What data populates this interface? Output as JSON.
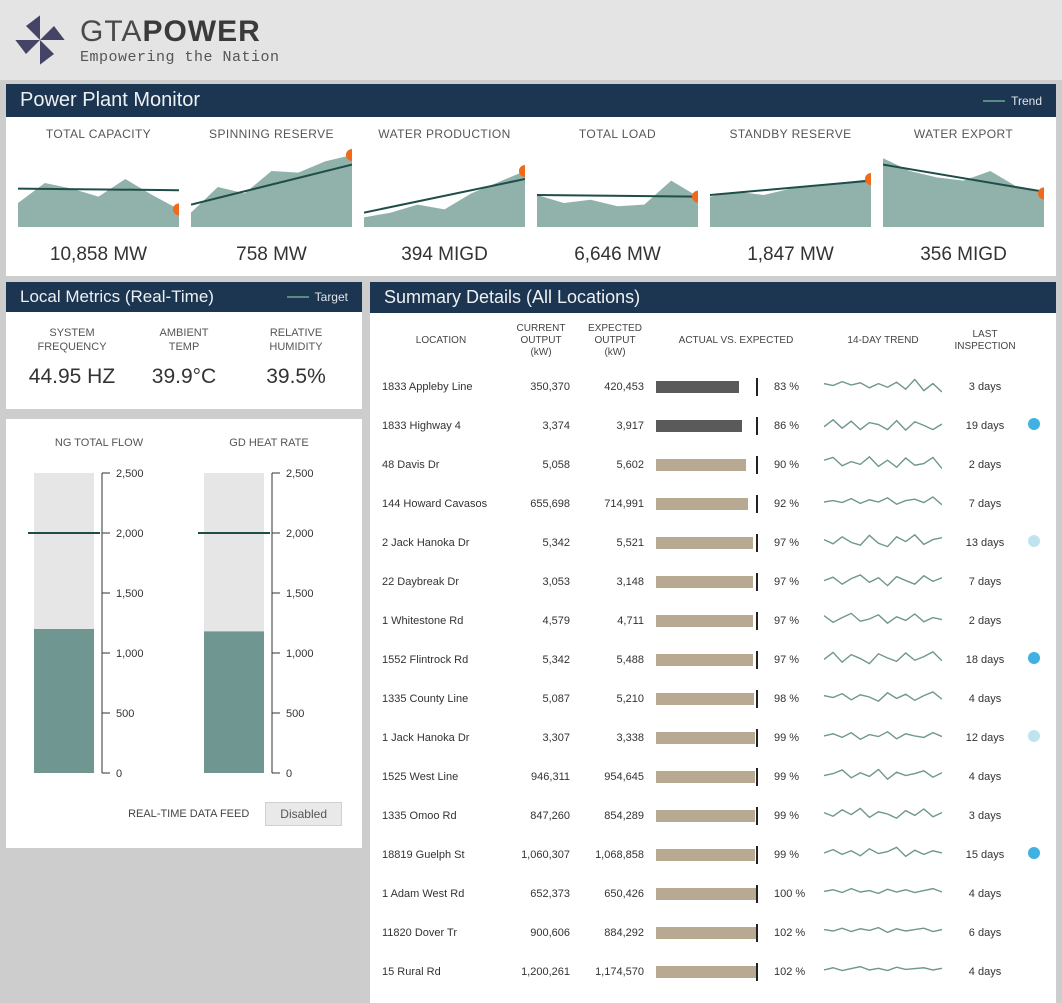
{
  "brand": {
    "name1": "GTA",
    "name2": "POWER",
    "tagline": "Empowering the Nation"
  },
  "sections": {
    "monitor": "Power Plant Monitor",
    "local": "Local Metrics (Real-Time)",
    "summary": "Summary Details (All Locations)"
  },
  "legend": {
    "trend": "Trend",
    "target": "Target"
  },
  "chart_data": {
    "sparks": [
      {
        "title": "TOTAL CAPACITY",
        "value": "10,858 MW",
        "area": [
          30,
          55,
          48,
          38,
          60,
          40,
          22
        ],
        "trend_y": [
          48,
          46
        ],
        "dot": [
          6,
          22
        ]
      },
      {
        "title": "SPINNING RESERVE",
        "value": "758 MW",
        "area": [
          18,
          50,
          42,
          70,
          68,
          82,
          90
        ],
        "trend_y": [
          28,
          78
        ],
        "dot": [
          6,
          90
        ]
      },
      {
        "title": "WATER PRODUCTION",
        "value": "394 MIGD",
        "area": [
          12,
          18,
          28,
          22,
          42,
          56,
          70
        ],
        "trend_y": [
          18,
          60
        ],
        "dot": [
          6,
          70
        ]
      },
      {
        "title": "TOTAL LOAD",
        "value": "6,646 MW",
        "area": [
          40,
          30,
          34,
          26,
          28,
          58,
          38
        ],
        "trend_y": [
          40,
          38
        ],
        "dot": [
          6,
          38
        ]
      },
      {
        "title": "STANDBY RESERVE",
        "value": "1,847 MW",
        "area": [
          38,
          44,
          40,
          48,
          52,
          56,
          60
        ],
        "trend_y": [
          40,
          58
        ],
        "dot": [
          6,
          60
        ]
      },
      {
        "title": "WATER EXPORT",
        "value": "356 MIGD",
        "area": [
          86,
          70,
          62,
          58,
          70,
          50,
          42
        ],
        "trend_y": [
          78,
          44
        ],
        "dot": [
          6,
          42
        ]
      }
    ],
    "local_bars": [
      {
        "title": "NG TOTAL FLOW",
        "max": 2500,
        "value": 1200,
        "target": 2000,
        "ticks": [
          0,
          500,
          1000,
          1500,
          2000,
          2500
        ]
      },
      {
        "title": "GD HEAT RATE",
        "max": 2500,
        "value": 1180,
        "target": 2000,
        "ticks": [
          0,
          500,
          1000,
          1500,
          2000,
          2500
        ]
      }
    ]
  },
  "metrics": [
    {
      "title1": "SYSTEM",
      "title2": "FREQUENCY",
      "value": "44.95 HZ"
    },
    {
      "title1": "AMBIENT",
      "title2": "TEMP",
      "value": "39.9°C"
    },
    {
      "title1": "RELATIVE",
      "title2": "HUMIDITY",
      "value": "39.5%"
    }
  ],
  "feed": {
    "label": "REAL-TIME DATA FEED",
    "state": "Disabled"
  },
  "summary": {
    "headers": {
      "location": "LOCATION",
      "current": "CURRENT OUTPUT (kW)",
      "expected": "EXPECTED OUTPUT (kW)",
      "actual": "ACTUAL VS. EXPECTED",
      "trend": "14-DAY TREND",
      "insp": "LAST INSPECTION"
    },
    "rows": [
      {
        "loc": "1833 Appleby Line",
        "cur": "350,370",
        "exp": "420,453",
        "pct": 83,
        "dark": true,
        "insp": "3 days",
        "dot": "",
        "trend": [
          55,
          48,
          62,
          50,
          58,
          40,
          55,
          42,
          60,
          35,
          70,
          30,
          55,
          25
        ]
      },
      {
        "loc": "1833 Highway 4",
        "cur": "3,374",
        "exp": "3,917",
        "pct": 86,
        "dark": true,
        "insp": "19 days",
        "dot": "blue",
        "trend": [
          40,
          65,
          35,
          60,
          30,
          55,
          48,
          30,
          62,
          28,
          58,
          45,
          30,
          50
        ]
      },
      {
        "loc": "48 Davis Dr",
        "cur": "5,058",
        "exp": "5,602",
        "pct": 90,
        "insp": "2 days",
        "dot": "",
        "trend": [
          60,
          70,
          40,
          55,
          45,
          72,
          38,
          60,
          35,
          68,
          42,
          48,
          70,
          30
        ]
      },
      {
        "loc": "144 Howard Cavasos",
        "cur": "655,698",
        "exp": "714,991",
        "pct": 92,
        "insp": "7 days",
        "dot": "",
        "trend": [
          50,
          55,
          48,
          62,
          45,
          58,
          50,
          65,
          42,
          55,
          60,
          48,
          68,
          40
        ]
      },
      {
        "loc": "2 Jack Hanoka Dr",
        "cur": "5,342",
        "exp": "5,521",
        "pct": 97,
        "insp": "13 days",
        "dot": "lblue",
        "trend": [
          55,
          40,
          65,
          45,
          35,
          70,
          42,
          30,
          65,
          48,
          72,
          38,
          55,
          62
        ]
      },
      {
        "loc": "22 Daybreak Dr",
        "cur": "3,053",
        "exp": "3,148",
        "pct": 97,
        "insp": "7 days",
        "dot": "",
        "trend": [
          48,
          60,
          35,
          55,
          68,
          42,
          58,
          30,
          62,
          48,
          35,
          65,
          45,
          58
        ]
      },
      {
        "loc": "1 Whitestone Rd",
        "cur": "4,579",
        "exp": "4,711",
        "pct": 97,
        "insp": "2 days",
        "dot": "",
        "trend": [
          62,
          38,
          55,
          70,
          42,
          50,
          65,
          35,
          58,
          45,
          68,
          40,
          55,
          48
        ]
      },
      {
        "loc": "1552 Flintrock Rd",
        "cur": "5,342",
        "exp": "5,488",
        "pct": 97,
        "insp": "18 days",
        "dot": "blue",
        "trend": [
          45,
          70,
          35,
          62,
          48,
          30,
          65,
          50,
          38,
          68,
          42,
          55,
          72,
          40
        ]
      },
      {
        "loc": "1335 County Line",
        "cur": "5,087",
        "exp": "5,210",
        "pct": 98,
        "insp": "4 days",
        "dot": "",
        "trend": [
          55,
          48,
          62,
          40,
          58,
          50,
          35,
          65,
          45,
          60,
          38,
          55,
          68,
          42
        ]
      },
      {
        "loc": "1 Jack Hanoka Dr",
        "cur": "3,307",
        "exp": "3,338",
        "pct": 99,
        "insp": "12 days",
        "dot": "lblue",
        "trend": [
          50,
          58,
          45,
          62,
          38,
          55,
          48,
          65,
          40,
          58,
          50,
          45,
          62,
          48
        ]
      },
      {
        "loc": "1525 West Line",
        "cur": "946,311",
        "exp": "954,645",
        "pct": 99,
        "insp": "4 days",
        "dot": "",
        "trend": [
          48,
          55,
          68,
          40,
          58,
          45,
          70,
          35,
          60,
          48,
          55,
          65,
          42,
          58
        ]
      },
      {
        "loc": "1335 Omoo Rd",
        "cur": "847,260",
        "exp": "854,289",
        "pct": 99,
        "insp": "3 days",
        "dot": "",
        "trend": [
          55,
          42,
          65,
          48,
          70,
          38,
          58,
          50,
          35,
          62,
          45,
          68,
          40,
          55
        ]
      },
      {
        "loc": "18819 Guelph St",
        "cur": "1,060,307",
        "exp": "1,068,858",
        "pct": 99,
        "insp": "15 days",
        "dot": "blue",
        "trend": [
          50,
          62,
          45,
          58,
          40,
          65,
          48,
          55,
          70,
          38,
          60,
          45,
          58,
          50
        ]
      },
      {
        "loc": "1 Adam West Rd",
        "cur": "652,373",
        "exp": "650,426",
        "pct": 100,
        "insp": "4 days",
        "dot": "",
        "trend": [
          52,
          58,
          48,
          62,
          50,
          55,
          45,
          60,
          50,
          58,
          48,
          55,
          62,
          50
        ]
      },
      {
        "loc": "11820 Dover Tr",
        "cur": "900,606",
        "exp": "884,292",
        "pct": 102,
        "insp": "6 days",
        "dot": "",
        "trend": [
          55,
          50,
          60,
          48,
          58,
          52,
          62,
          45,
          58,
          50,
          55,
          60,
          48,
          55
        ]
      },
      {
        "loc": "15 Rural Rd",
        "cur": "1,200,261",
        "exp": "1,174,570",
        "pct": 102,
        "insp": "4 days",
        "dot": "",
        "trend": [
          50,
          58,
          48,
          55,
          62,
          50,
          56,
          48,
          60,
          52,
          55,
          58,
          50,
          56
        ]
      }
    ]
  }
}
